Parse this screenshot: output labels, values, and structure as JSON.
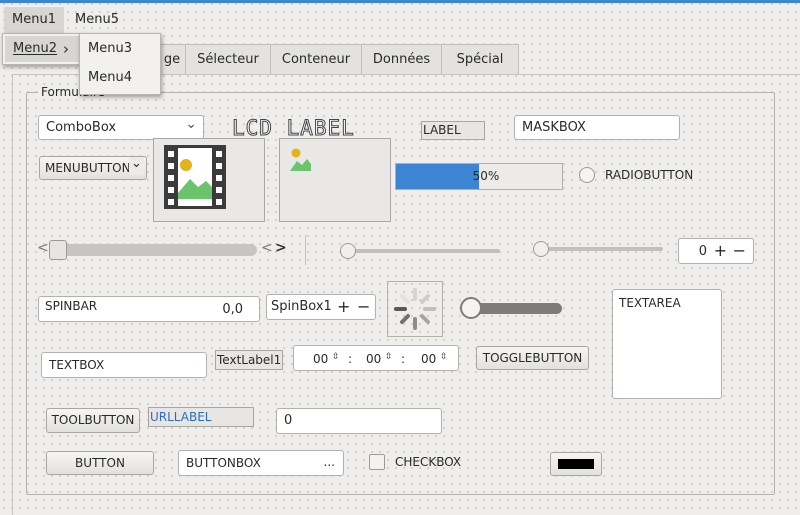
{
  "menubar": {
    "items": [
      {
        "label": "Menu1"
      },
      {
        "label": "Menu5"
      }
    ],
    "menu1_popup": {
      "item_label": "Menu2",
      "arrow": "›"
    },
    "menu2_popup": {
      "items": [
        {
          "label": "Menu3"
        },
        {
          "label": "Menu4"
        }
      ]
    }
  },
  "tabs": [
    {
      "label": "ge"
    },
    {
      "label": "Sélecteur"
    },
    {
      "label": "Conteneur"
    },
    {
      "label": "Données"
    },
    {
      "label": "Spécial"
    }
  ],
  "group": {
    "title": "Formulaire"
  },
  "combobox": {
    "value": "ComboBox",
    "arrow": "⌄"
  },
  "lcd_label": {
    "text": "LCD LABEL"
  },
  "label": {
    "text": "LABEL"
  },
  "maskbox": {
    "value": "MASKBOX"
  },
  "menubutton": {
    "label": "MENUBUTTON",
    "arrow": "⌄"
  },
  "progressbar": {
    "value_text": "50%",
    "fraction": 0.5
  },
  "radiobutton": {
    "label": "RADIOBUTTON",
    "checked": false
  },
  "scrollbar": {
    "left_arrow": "<",
    "right_arrow_a": "<",
    "right_arrow_b": ">",
    "value": 0.0
  },
  "slider1": {
    "value": 0.0
  },
  "slider2": {
    "value": 0.0
  },
  "spinbox_right": {
    "value": "0",
    "plus": "+",
    "minus": "−"
  },
  "spinbar": {
    "label": "SPINBAR",
    "value": "0,0"
  },
  "spinbox1": {
    "value": "SpinBox1",
    "plus": "+",
    "minus": "−"
  },
  "switch": {
    "on": false
  },
  "textarea": {
    "value": "TEXTAREA"
  },
  "textbox": {
    "value": "TEXTBOX"
  },
  "textlabel": {
    "text": "TextLabel1"
  },
  "timebox": {
    "hours": "00",
    "minutes": "00",
    "seconds": "00",
    "sep": ":"
  },
  "togglebutton": {
    "label": "TOGGLEBUTTON"
  },
  "toolbutton": {
    "label": "TOOLBUTTON"
  },
  "urllabel": {
    "text": "URLLABEL"
  },
  "valuebox": {
    "value": "0"
  },
  "button": {
    "label": "BUTTON"
  },
  "buttonbox": {
    "value": "BUTTONBOX",
    "dots": "..."
  },
  "checkbox": {
    "label": "CHECKBOX",
    "checked": false
  },
  "colorbutton": {
    "color": "#000000"
  },
  "colors": {
    "accent": "#3d84d2",
    "url": "#2a6fbf",
    "progress": "#3d84d2"
  }
}
